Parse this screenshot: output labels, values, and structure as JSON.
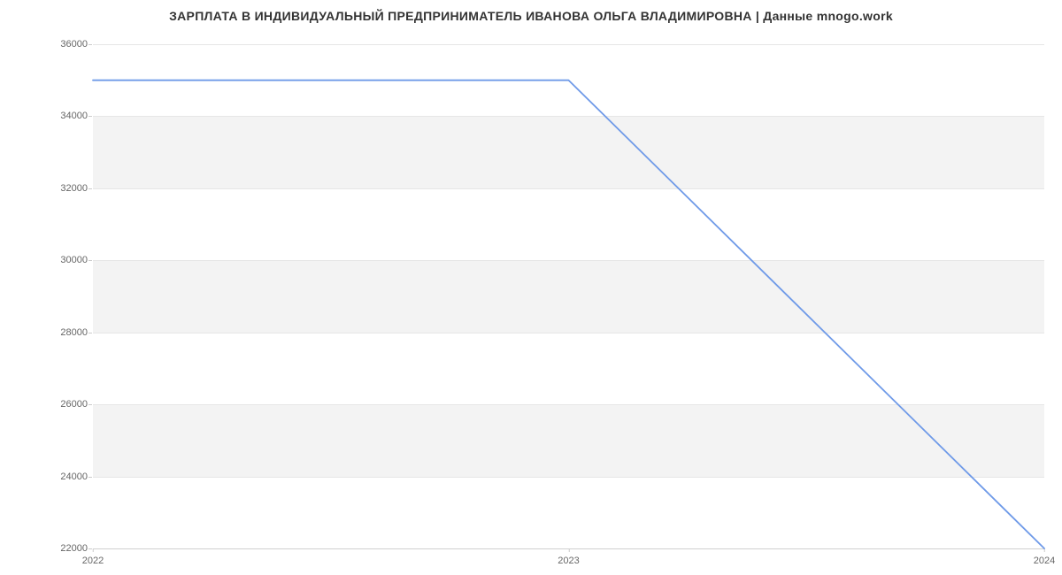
{
  "chart_data": {
    "type": "line",
    "title": "ЗАРПЛАТА В ИНДИВИДУАЛЬНЫЙ ПРЕДПРИНИМАТЕЛЬ ИВАНОВА ОЛЬГА ВЛАДИМИРОВНА | Данные mnogo.work",
    "xlabel": "",
    "ylabel": "",
    "x": [
      2022,
      2023,
      2024
    ],
    "x_tick_labels": [
      "2022",
      "2023",
      "2024"
    ],
    "series": [
      {
        "name": "Зарплата",
        "values": [
          35000,
          35000,
          22000
        ],
        "color": "#6f9ae8"
      }
    ],
    "y_ticks": [
      22000,
      24000,
      26000,
      28000,
      30000,
      32000,
      34000,
      36000
    ],
    "ylim": [
      22000,
      36000
    ],
    "xlim": [
      2022,
      2024
    ],
    "grid": true,
    "legend": false
  }
}
